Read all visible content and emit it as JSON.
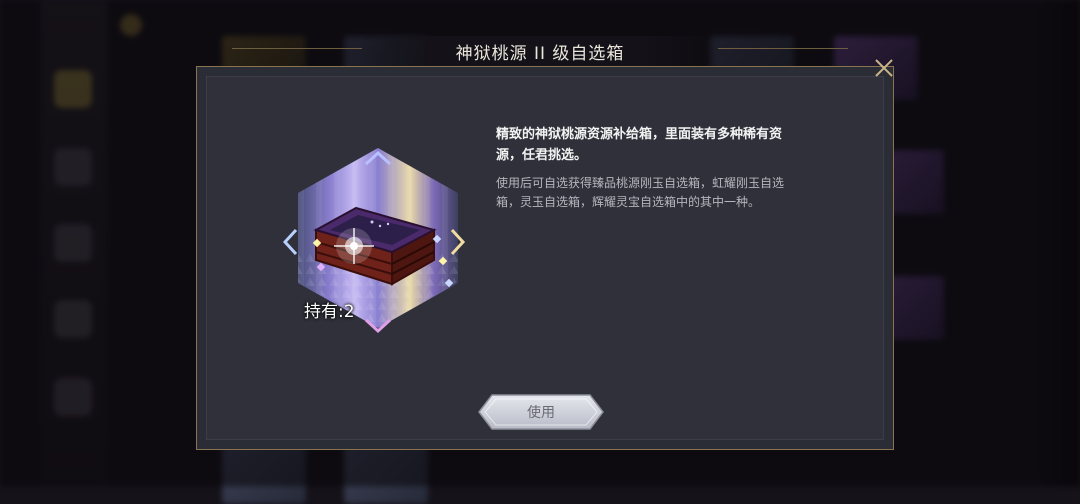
{
  "dialog": {
    "title": "神狱桃源 II 级自选箱",
    "owned_label": "持有:2",
    "description_main": "精致的神狱桃源资源补给箱，里面装有多种稀有资源，任君挑选。",
    "description_detail": "使用后可自选获得臻品桃源刚玉自选箱，虹耀刚玉自选箱，灵玉自选箱，辉耀灵宝自选箱中的其中一种。",
    "use_button_label": "使用",
    "close_icon": "close-icon"
  },
  "colors": {
    "modal_border": "#8a7450",
    "modal_bg": "#2f3039",
    "title_text": "#eae6dc",
    "accent_purple": "#8a7fd0",
    "chest_wood": "#7a2a20"
  }
}
